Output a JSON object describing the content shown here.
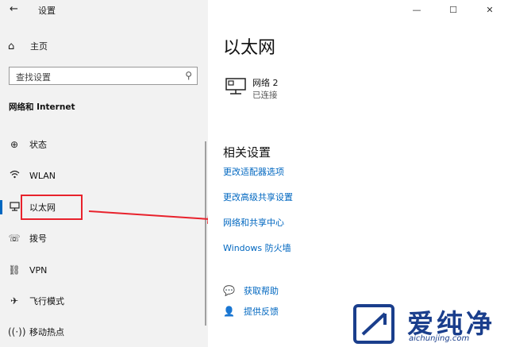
{
  "app": {
    "back_symbol": "←",
    "title": "设置"
  },
  "window_controls": {
    "minimize": "—",
    "maximize": "☐",
    "close": "✕"
  },
  "sidebar": {
    "home_label": "主页",
    "search_placeholder": "查找设置",
    "section_title": "网络和 Internet",
    "items": [
      {
        "label": "状态",
        "icon": "globe-icon"
      },
      {
        "label": "WLAN",
        "icon": "wifi-icon"
      },
      {
        "label": "以太网",
        "icon": "ethernet-icon",
        "selected": true
      },
      {
        "label": "拨号",
        "icon": "dialup-icon"
      },
      {
        "label": "VPN",
        "icon": "vpn-icon"
      },
      {
        "label": "飞行模式",
        "icon": "airplane-icon"
      },
      {
        "label": "移动热点",
        "icon": "hotspot-icon"
      }
    ]
  },
  "main": {
    "title": "以太网",
    "network": {
      "name": "网络 2",
      "status": "已连接"
    },
    "related_title": "相关设置",
    "links": [
      "更改适配器选项",
      "更改高级共享设置",
      "网络和共享中心",
      "Windows 防火墙"
    ],
    "help": {
      "get_help": "获取帮助",
      "feedback": "提供反馈"
    }
  },
  "watermark": {
    "brand": "爱纯净",
    "url": "aichunjing.com"
  },
  "colors": {
    "accent": "#0067c0",
    "annotation_red": "#e8222c",
    "watermark_blue": "#1a3e8c"
  }
}
